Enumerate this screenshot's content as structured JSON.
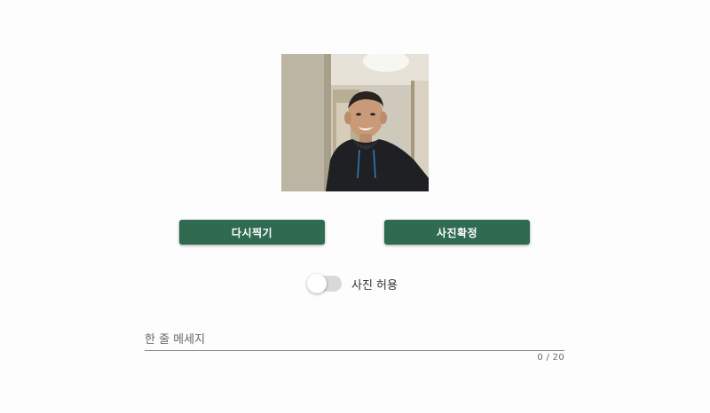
{
  "photo": {
    "description_icon": "webcam-photo"
  },
  "buttons": {
    "retake_label": "다시찍기",
    "confirm_label": "사진확정",
    "color": "#2f6a51"
  },
  "permission": {
    "label": "사진 허용",
    "enabled": false
  },
  "message": {
    "placeholder": "한 줄 메세지",
    "value": "",
    "counter": "0 / 20"
  }
}
